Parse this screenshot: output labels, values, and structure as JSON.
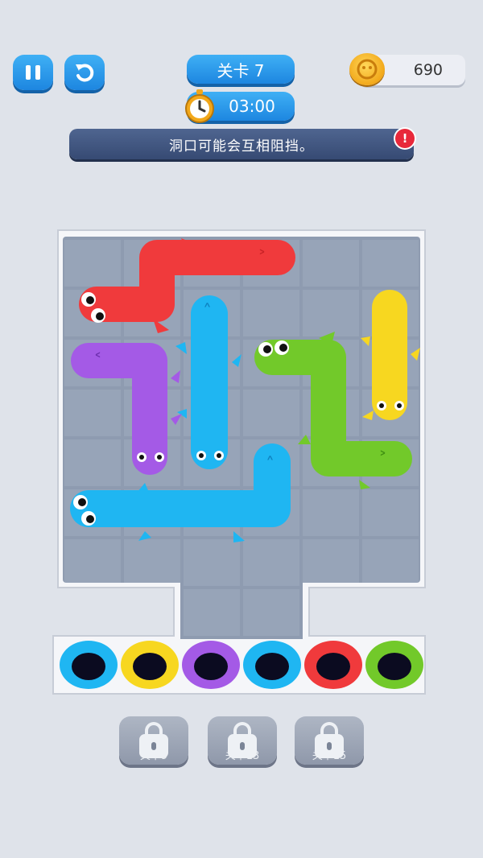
{
  "hud": {
    "level_label": "关卡 7",
    "timer": "03:00",
    "coins": "690",
    "hint": "洞口可能会互相阻挡。",
    "alert": "!"
  },
  "icons": [
    "pause-icon",
    "undo-icon",
    "stopwatch-icon",
    "coin-icon",
    "lock-icon"
  ],
  "colors": {
    "red": "#f03a3c",
    "blue": "#1fb6f2",
    "purple": "#a45ae6",
    "green": "#72c92a",
    "yellow": "#f7d720",
    "accent": "#1d86e0"
  },
  "holes": [
    {
      "color": "blue"
    },
    {
      "color": "yellow"
    },
    {
      "color": "purple"
    },
    {
      "color": "blue"
    },
    {
      "color": "red"
    },
    {
      "color": "green"
    }
  ],
  "locked_levels": [
    {
      "label": "关卡9"
    },
    {
      "label": "关卡13"
    },
    {
      "label": "关卡15"
    }
  ]
}
